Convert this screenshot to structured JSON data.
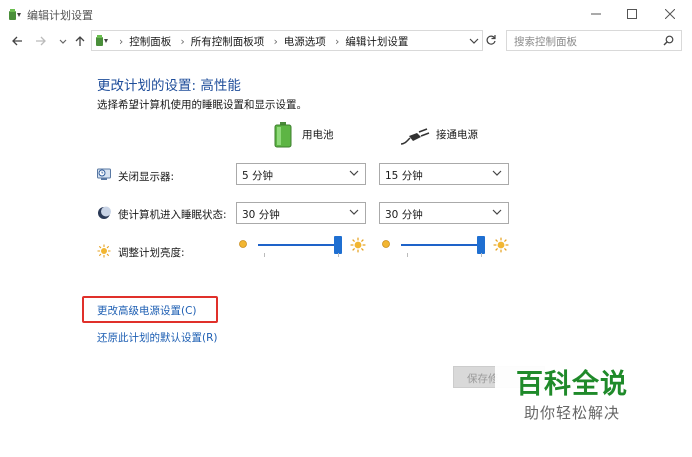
{
  "window": {
    "title": "编辑计划设置",
    "controls": {
      "minimize": "—",
      "maximize": "☐",
      "close": "✕"
    }
  },
  "navbar": {
    "back_icon": "back-arrow-icon",
    "forward_icon": "forward-arrow-icon",
    "recent_icon": "chevron-down-icon",
    "up_icon": "up-arrow-icon",
    "breadcrumbs": [
      "控制面板",
      "所有控制面板项",
      "电源选项",
      "编辑计划设置"
    ],
    "search_placeholder": "搜索控制面板"
  },
  "content": {
    "heading": "更改计划的设置: 高性能",
    "subheading": "选择希望计算机使用的睡眠设置和显示设置。",
    "columns": {
      "battery": "用电池",
      "plugged": "接通电源"
    },
    "rows": [
      {
        "label": "关闭显示器:",
        "battery": "5 分钟",
        "plugged": "15 分钟"
      },
      {
        "label": "使计算机进入睡眠状态:",
        "battery": "30 分钟",
        "plugged": "30 分钟"
      },
      {
        "label": "调整计划亮度:"
      }
    ],
    "brightness": {
      "battery_level": 1.0,
      "plugged_level": 1.0
    },
    "links": {
      "advanced": "更改高级电源设置(C)",
      "restore": "还原此计划的默认设置(R)"
    },
    "save_button": "保存修"
  },
  "watermark": {
    "title": "百科全说",
    "subtitle": "助你轻松解决"
  },
  "colors": {
    "heading": "#1e4d9a",
    "link": "#1e5fb3",
    "highlight": "#e0302a",
    "watermark_green": "#1f8a2a",
    "slider": "#1f6fd1"
  }
}
